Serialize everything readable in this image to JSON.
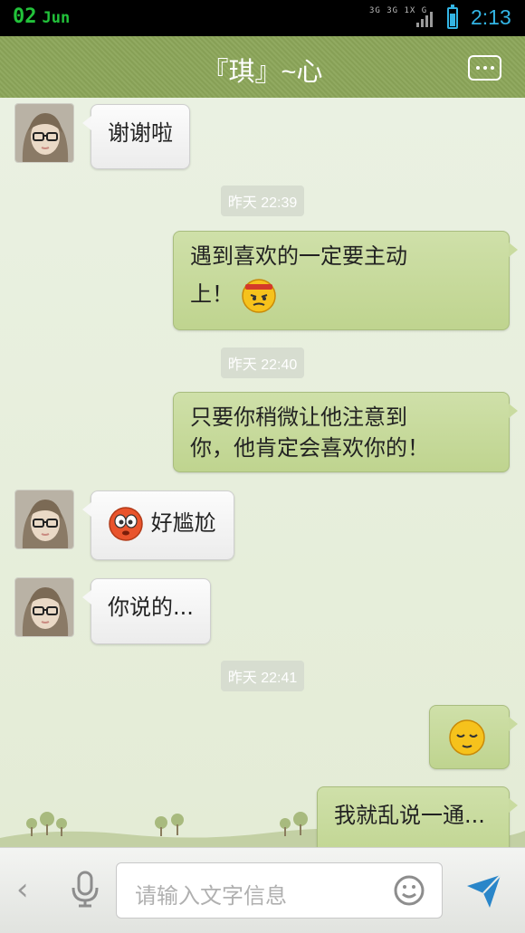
{
  "status_bar": {
    "day": "02",
    "month": "Jun",
    "time": "2:13",
    "network": "3G 3G 1X G"
  },
  "header": {
    "title": "『琪』~心",
    "more_icon": "more-dots-icon"
  },
  "messages": [
    {
      "side": "left",
      "text": "谢谢啦"
    },
    {
      "type": "time",
      "text": "昨天 22:39"
    },
    {
      "side": "right",
      "line1": "遇到喜欢的一定要主动",
      "line2": "上！",
      "emoji": "sweating-headband-face"
    },
    {
      "type": "time",
      "text": "昨天 22:40"
    },
    {
      "side": "right",
      "line1": "只要你稍微让他注意到",
      "line2": "你，他肯定会喜欢你的！"
    },
    {
      "side": "left",
      "text": "好尴尬",
      "emoji": "embarrassed-face"
    },
    {
      "side": "left",
      "text": "你说的..."
    },
    {
      "type": "time",
      "text": "昨天 22:41"
    },
    {
      "side": "right",
      "emoji": "relieved-face"
    },
    {
      "side": "right",
      "text": "我就乱说一通..."
    }
  ],
  "input_bar": {
    "placeholder": "请输入文字信息",
    "icons": [
      "back-chevron-icon",
      "microphone-icon",
      "emoji-smile-icon",
      "send-icon"
    ]
  },
  "colors": {
    "header_green": "#8ba559",
    "right_bubble": "#c5d99a",
    "left_bubble": "#f5f5f5",
    "chat_bg": "#e6eedb",
    "timestamp_bg": "#d7ddd0"
  }
}
